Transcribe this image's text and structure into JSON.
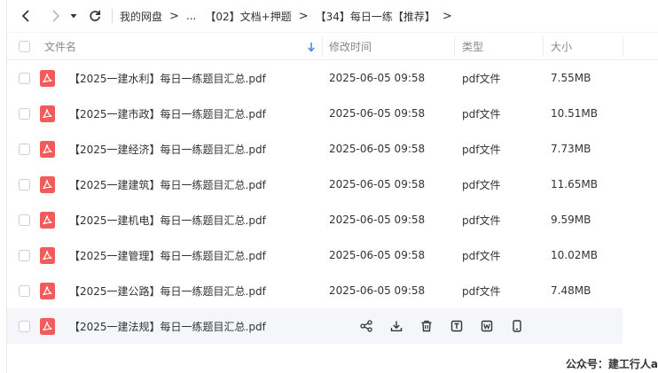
{
  "breadcrumb": [
    "我的网盘",
    "...",
    "【02】文档+押题",
    "【34】每日一练【推荐】"
  ],
  "columns": {
    "name": "文件名",
    "modified": "修改时间",
    "type": "类型",
    "size": "大小"
  },
  "files": [
    {
      "name": "【2025一建水利】每日一练题目汇总.pdf",
      "modified": "2025-06-05 09:58",
      "type": "pdf文件",
      "size": "7.55MB"
    },
    {
      "name": "【2025一建市政】每日一练题目汇总.pdf",
      "modified": "2025-06-05 09:58",
      "type": "pdf文件",
      "size": "10.51MB"
    },
    {
      "name": "【2025一建经济】每日一练题目汇总.pdf",
      "modified": "2025-06-05 09:58",
      "type": "pdf文件",
      "size": "7.73MB"
    },
    {
      "name": "【2025一建建筑】每日一练题目汇总.pdf",
      "modified": "2025-06-05 09:58",
      "type": "pdf文件",
      "size": "11.65MB"
    },
    {
      "name": "【2025一建机电】每日一练题目汇总.pdf",
      "modified": "2025-06-05 09:58",
      "type": "pdf文件",
      "size": "9.59MB"
    },
    {
      "name": "【2025一建管理】每日一练题目汇总.pdf",
      "modified": "2025-06-05 09:58",
      "type": "pdf文件",
      "size": "10.02MB"
    },
    {
      "name": "【2025一建公路】每日一练题目汇总.pdf",
      "modified": "2025-06-05 09:58",
      "type": "pdf文件",
      "size": "7.48MB"
    }
  ],
  "hovered_file": {
    "name": "【2025一建法规】每日一练题目汇总.pdf"
  },
  "row_actions": [
    "share-icon",
    "download-icon",
    "delete-icon",
    "text-extract-icon",
    "word-convert-icon",
    "mobile-icon"
  ],
  "watermark": "公众号：建工行人a",
  "colors": {
    "pdf_icon": "#f25b5b",
    "accent": "#3b82f6",
    "hover_row": "#f5f6fa"
  }
}
